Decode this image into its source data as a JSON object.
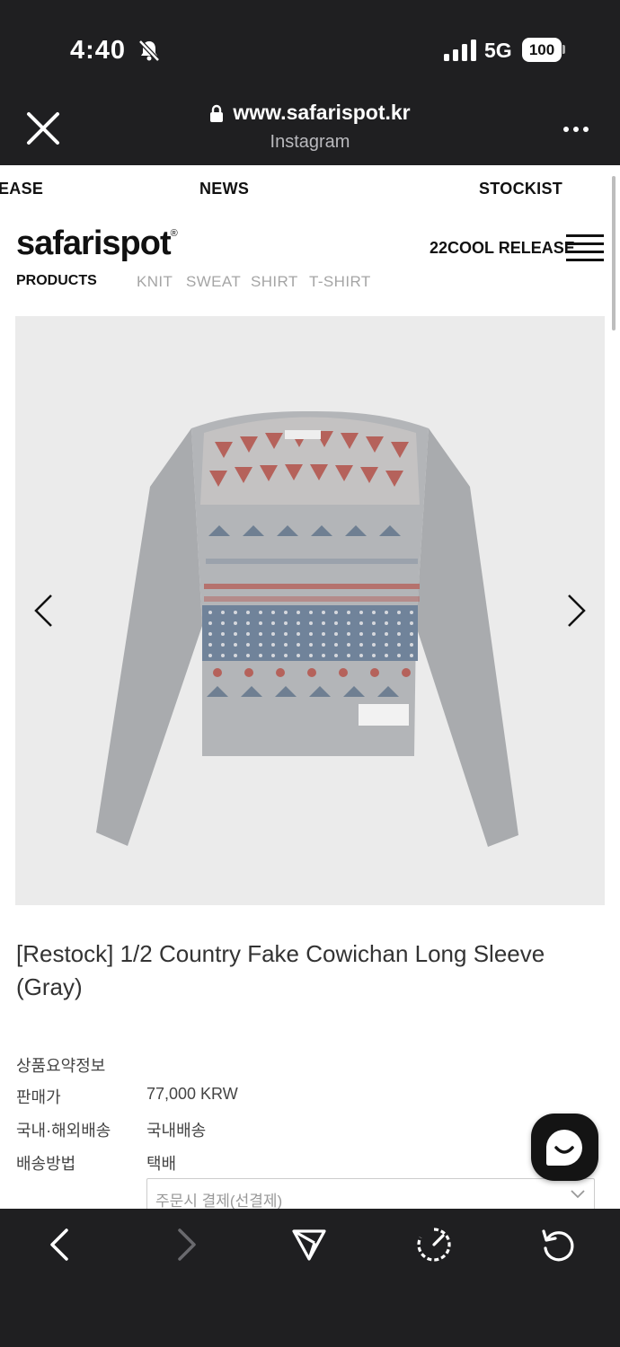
{
  "status_bar": {
    "time": "4:40",
    "network": "5G",
    "battery": "100"
  },
  "browser": {
    "url": "www.safarispot.kr",
    "source_app": "Instagram"
  },
  "site": {
    "nav_top": [
      "EASE",
      "NEWS",
      "STOCKIST"
    ],
    "logo": "safarispot",
    "logo_mark": "®",
    "release_link": "22COOL RELEASE",
    "category_label": "PRODUCTS",
    "categories": [
      "KNIT",
      "SWEAT",
      "SHIRT",
      "T-SHIRT"
    ]
  },
  "product": {
    "title": "[Restock] 1/2 Country Fake Cowichan Long Sleeve (Gray)",
    "summary_heading": "상품요약정보",
    "rows": [
      {
        "label": "판매가",
        "value": "77,000 KRW"
      },
      {
        "label": "국내·해외배송",
        "value": "국내배송"
      },
      {
        "label": "배송방법",
        "value": "택배"
      }
    ],
    "payment_select": "주문시 결제(선결제)"
  },
  "icons": {
    "close": "close-icon",
    "more": "more-icon",
    "prev": "chevron-left-icon",
    "next": "chevron-right-icon",
    "share": "share-icon",
    "speed": "speed-icon",
    "reload": "reload-icon",
    "chat": "chat-icon"
  }
}
